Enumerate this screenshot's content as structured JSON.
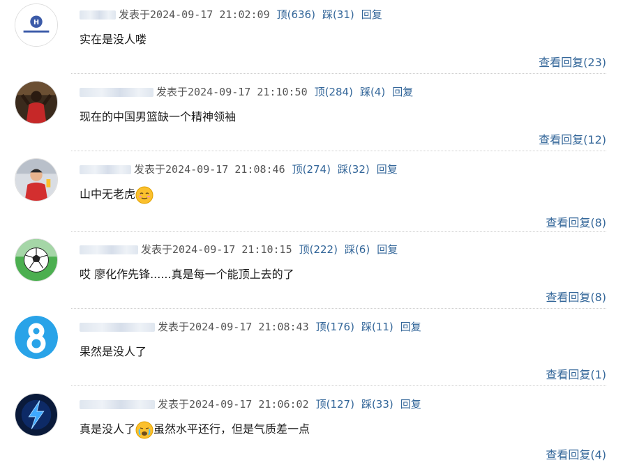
{
  "comments": [
    {
      "username": "",
      "posted_label": "发表于",
      "timestamp": "2024-09-17 21:02:09",
      "ding": "顶(636)",
      "cai": "踩(31)",
      "reply": "回复",
      "content": "实在是没人喽",
      "view_replies": "查看回复(23)",
      "avatar_icon": "hq-logo-avatar"
    },
    {
      "username": "",
      "posted_label": "发表于",
      "timestamp": "2024-09-17 21:10:50",
      "ding": "顶(284)",
      "cai": "踩(4)",
      "reply": "回复",
      "content": "现在的中国男篮缺一个精神领袖",
      "view_replies": "查看回复(12)",
      "avatar_icon": "player-avatar"
    },
    {
      "username": "",
      "posted_label": "发表于",
      "timestamp": "2024-09-17 21:08:46",
      "ding": "顶(274)",
      "cai": "踩(32)",
      "reply": "回复",
      "content": "山中无老虎",
      "view_replies": "查看回复(8)",
      "avatar_icon": "referee-avatar",
      "emoji": "relieved-face"
    },
    {
      "username": "",
      "posted_label": "发表于",
      "timestamp": "2024-09-17 21:10:15",
      "ding": "顶(222)",
      "cai": "踩(6)",
      "reply": "回复",
      "content": "哎 廖化作先锋......真是每一个能顶上去的了",
      "view_replies": "查看回复(8)",
      "avatar_icon": "soccer-ball-avatar"
    },
    {
      "username": "",
      "posted_label": "发表于",
      "timestamp": "2024-09-17 21:08:43",
      "ding": "顶(176)",
      "cai": "踩(11)",
      "reply": "回复",
      "content": "果然是没人了",
      "view_replies": "查看回复(1)",
      "avatar_icon": "number-8-avatar"
    },
    {
      "username": "",
      "posted_label": "发表于",
      "timestamp": "2024-09-17 21:06:02",
      "ding": "顶(127)",
      "cai": "踩(33)",
      "reply": "回复",
      "content": "真是没人了",
      "content_after": "虽然水平还行，但是气质差一点",
      "view_replies": "查看回复(4)",
      "avatar_icon": "lightning-avatar",
      "emoji": "crying-face"
    }
  ],
  "colors": {
    "link": "#336699",
    "text": "#1a1a1a",
    "meta": "#555555"
  }
}
